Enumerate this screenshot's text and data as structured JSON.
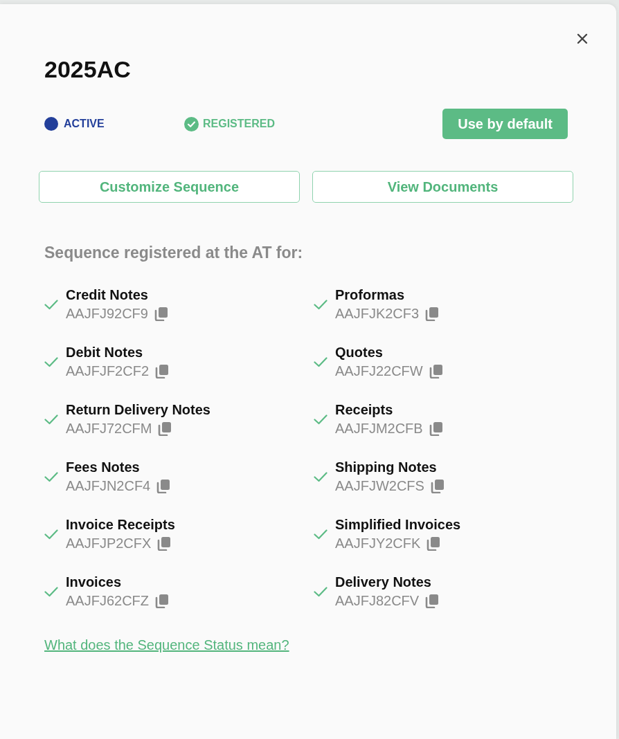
{
  "window": {
    "title": "2025AC"
  },
  "statuses": [
    {
      "kind": "dot",
      "label": "ACTIVE",
      "color": "#233f9a"
    },
    {
      "kind": "check",
      "label": "REGISTERED",
      "color": "#5cbb85"
    }
  ],
  "default_button": "Use by default",
  "actions": [
    "Customize Sequence",
    "View Documents"
  ],
  "registered_section": {
    "heading": "Sequence registered at the AT for:",
    "items": [
      {
        "name": "Credit Notes",
        "code": "AAJFJ92CF9",
        "checked": true
      },
      {
        "name": "Debit Notes",
        "code": "AAJFJF2CF2",
        "checked": true
      },
      {
        "name": "Return Delivery Notes",
        "code": "AAJFJ72CFM",
        "checked": true
      },
      {
        "name": "Fees Notes",
        "code": "AAJFJN2CF4",
        "checked": true
      },
      {
        "name": "Invoice Receipts",
        "code": "AAJFJP2CFX",
        "checked": true
      },
      {
        "name": "Invoices",
        "code": "AAJFJ62CFZ",
        "checked": true
      },
      {
        "name": "Proformas",
        "code": "AAJFJK2CF3",
        "checked": true
      },
      {
        "name": "Quotes",
        "code": "AAJFJ22CFW",
        "checked": true
      },
      {
        "name": "Receipts",
        "code": "AAJFJM2CFB",
        "checked": true
      },
      {
        "name": "Shipping Notes",
        "code": "AAJFJW2CFS",
        "checked": true
      },
      {
        "name": "Simplified Invoices",
        "code": "AAJFJY2CFK",
        "checked": true
      },
      {
        "name": "Delivery Notes",
        "code": "AAJFJ82CFV",
        "checked": true
      }
    ]
  },
  "help_link": "What does the Sequence Status mean?"
}
